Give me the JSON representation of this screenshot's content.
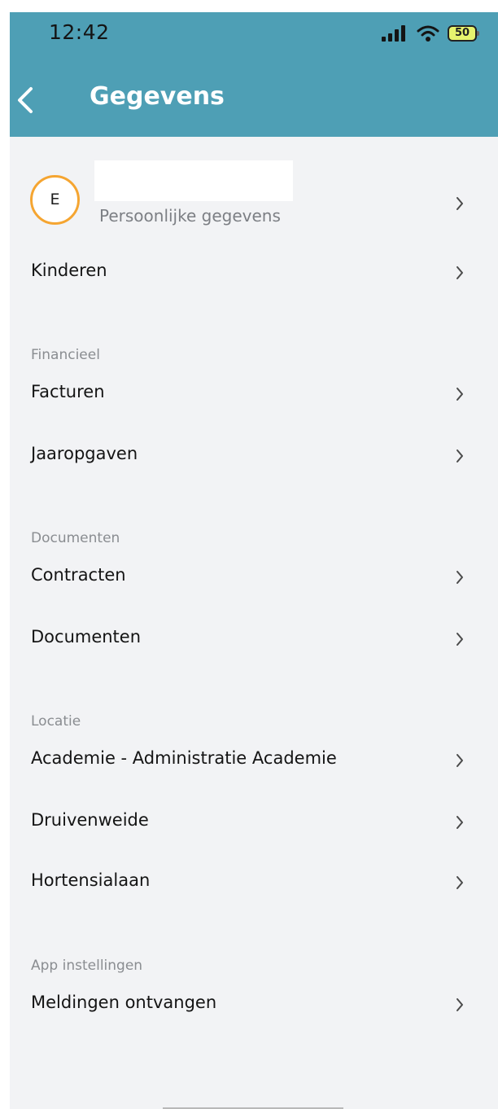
{
  "status_bar": {
    "time": "12:42",
    "battery": "50",
    "signal_icon": "cellular-signal-icon",
    "wifi_icon": "wifi-icon"
  },
  "header": {
    "title": "Gegevens",
    "back_icon": "chevron-left-icon",
    "background_color": "#4e9fb5"
  },
  "profile": {
    "avatar_initial": "E",
    "subtitle": "Persoonlijke gegevens",
    "accent_color": "#f5a531"
  },
  "items": {
    "kinderen": "Kinderen"
  },
  "sections": {
    "financieel": {
      "label": "Financieel",
      "items": [
        "Facturen",
        "Jaaropgaven"
      ]
    },
    "documenten": {
      "label": "Documenten",
      "items": [
        "Contracten",
        "Documenten"
      ]
    },
    "locatie": {
      "label": "Locatie",
      "items": [
        "Academie - Administratie Academie",
        "Druivenweide",
        "Hortensialaan"
      ]
    },
    "app_instellingen": {
      "label": "App instellingen",
      "items": [
        "Meldingen ontvangen"
      ]
    }
  }
}
